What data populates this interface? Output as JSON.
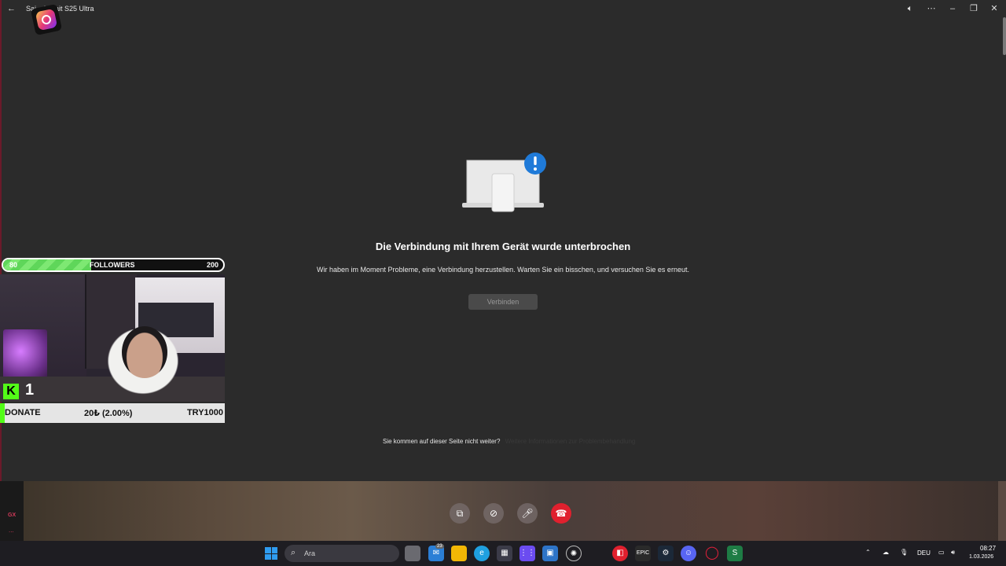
{
  "window": {
    "title": "Sai... iye ait S25 Ultra"
  },
  "error": {
    "heading": "Die Verbindung mit Ihrem Gerät wurde unterbrochen",
    "message": "Wir haben im Moment Probleme, eine Verbindung herzustellen. Warten Sie ein bisschen, und versuchen Sie es erneut.",
    "connect_label": "Verbinden",
    "help_text": "Sie kommen auf dieser Seite nicht weiter?",
    "help_link": "Weitere Informationen zur Problembehandlung"
  },
  "followers_bar": {
    "current": "80",
    "label": "FOLLOWERS",
    "goal": "200",
    "progress": 0.4
  },
  "stream_overlay": {
    "viewer_count": "1",
    "kick_logo": "K",
    "donate_label": "DONATE",
    "donate_amount": "20₺ (2.00%)",
    "donate_code": "TRY1000"
  },
  "sidebar_gx": {
    "label": "GX",
    "more": "..."
  },
  "taskbar": {
    "search_placeholder": "Ara",
    "badge_count": "23",
    "language": "DEU",
    "time": "08:27",
    "date": "1.03.2026"
  },
  "colors": {
    "accent_blue": "#1f7ad8",
    "end_call_red": "#e0202e",
    "kick_green": "#53fc18"
  }
}
